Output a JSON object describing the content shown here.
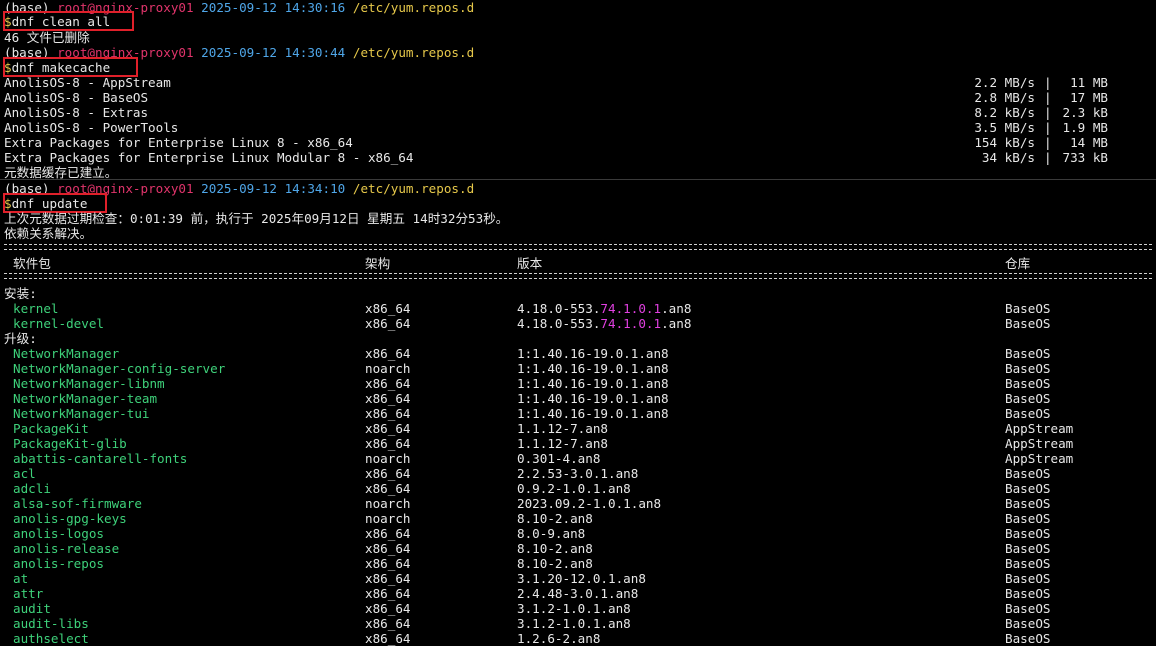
{
  "prompts": [
    {
      "env": "(base)",
      "user": "root@nginx-proxy01",
      "date": "2025-09-12",
      "time": "14:30:16",
      "path": "/etc/yum.repos.d",
      "cmd": "dnf clean all"
    },
    {
      "env": "(base)",
      "user": "root@nginx-proxy01",
      "date": "2025-09-12",
      "time": "14:30:44",
      "path": "/etc/yum.repos.d",
      "cmd": "dnf makecache"
    },
    {
      "env": "(base)",
      "user": "root@nginx-proxy01",
      "date": "2025-09-12",
      "time": "14:34:10",
      "path": "/etc/yum.repos.d",
      "cmd": "dnf update"
    }
  ],
  "dollar": "$",
  "clean_output": "46 文件已删除",
  "repos": [
    {
      "name": "AnolisOS-8 - AppStream",
      "speed": "2.2 MB/s",
      "size": " 11 MB"
    },
    {
      "name": "AnolisOS-8 - BaseOS",
      "speed": "2.8 MB/s",
      "size": " 17 MB"
    },
    {
      "name": "AnolisOS-8 - Extras",
      "speed": "8.2 kB/s",
      "size": "2.3 kB"
    },
    {
      "name": "AnolisOS-8 - PowerTools",
      "speed": "3.5 MB/s",
      "size": "1.9 MB"
    },
    {
      "name": "Extra Packages for Enterprise Linux 8 - x86_64",
      "speed": "154 kB/s",
      "size": " 14 MB"
    },
    {
      "name": "Extra Packages for Enterprise Linux Modular 8 - x86_64",
      "speed": " 34 kB/s",
      "size": "733 kB"
    }
  ],
  "sep_bar": "|",
  "makecache_done": "元数据缓存已建立。",
  "metadata_check": "上次元数据过期检查：0:01:39 前，执行于 2025年09月12日 星期五 14时32分53秒。",
  "deps_resolved": "依赖关系解决。",
  "table_headers": {
    "package": "软件包",
    "arch": "架构",
    "version": "版本",
    "repo": "仓库"
  },
  "section_install": "安装:",
  "section_upgrade": "升级:",
  "install_rows": [
    {
      "name": "kernel",
      "arch": "x86_64",
      "ver_a": "4.18.0-553.",
      "ver_b": "74.1.0.1",
      "ver_c": ".an8",
      "repo": "BaseOS"
    },
    {
      "name": "kernel-devel",
      "arch": "x86_64",
      "ver_a": "4.18.0-553.",
      "ver_b": "74.1.0.1",
      "ver_c": ".an8",
      "repo": "BaseOS"
    }
  ],
  "upgrade_rows": [
    {
      "name": "NetworkManager",
      "arch": "x86_64",
      "ver": "1:1.40.16-19.0.1.an8",
      "repo": "BaseOS"
    },
    {
      "name": "NetworkManager-config-server",
      "arch": "noarch",
      "ver": "1:1.40.16-19.0.1.an8",
      "repo": "BaseOS"
    },
    {
      "name": "NetworkManager-libnm",
      "arch": "x86_64",
      "ver": "1:1.40.16-19.0.1.an8",
      "repo": "BaseOS"
    },
    {
      "name": "NetworkManager-team",
      "arch": "x86_64",
      "ver": "1:1.40.16-19.0.1.an8",
      "repo": "BaseOS"
    },
    {
      "name": "NetworkManager-tui",
      "arch": "x86_64",
      "ver": "1:1.40.16-19.0.1.an8",
      "repo": "BaseOS"
    },
    {
      "name": "PackageKit",
      "arch": "x86_64",
      "ver": "1.1.12-7.an8",
      "repo": "AppStream"
    },
    {
      "name": "PackageKit-glib",
      "arch": "x86_64",
      "ver": "1.1.12-7.an8",
      "repo": "AppStream"
    },
    {
      "name": "abattis-cantarell-fonts",
      "arch": "noarch",
      "ver": "0.301-4.an8",
      "repo": "AppStream"
    },
    {
      "name": "acl",
      "arch": "x86_64",
      "ver": "2.2.53-3.0.1.an8",
      "repo": "BaseOS"
    },
    {
      "name": "adcli",
      "arch": "x86_64",
      "ver": "0.9.2-1.0.1.an8",
      "repo": "BaseOS"
    },
    {
      "name": "alsa-sof-firmware",
      "arch": "noarch",
      "ver": "2023.09.2-1.0.1.an8",
      "repo": "BaseOS"
    },
    {
      "name": "anolis-gpg-keys",
      "arch": "noarch",
      "ver": "8.10-2.an8",
      "repo": "BaseOS"
    },
    {
      "name": "anolis-logos",
      "arch": "x86_64",
      "ver": "8.0-9.an8",
      "repo": "BaseOS"
    },
    {
      "name": "anolis-release",
      "arch": "x86_64",
      "ver": "8.10-2.an8",
      "repo": "BaseOS"
    },
    {
      "name": "anolis-repos",
      "arch": "x86_64",
      "ver": "8.10-2.an8",
      "repo": "BaseOS"
    },
    {
      "name": "at",
      "arch": "x86_64",
      "ver": "3.1.20-12.0.1.an8",
      "repo": "BaseOS"
    },
    {
      "name": "attr",
      "arch": "x86_64",
      "ver": "2.4.48-3.0.1.an8",
      "repo": "BaseOS"
    },
    {
      "name": "audit",
      "arch": "x86_64",
      "ver": "3.1.2-1.0.1.an8",
      "repo": "BaseOS"
    },
    {
      "name": "audit-libs",
      "arch": "x86_64",
      "ver": "3.1.2-1.0.1.an8",
      "repo": "BaseOS"
    },
    {
      "name": "authselect",
      "arch": "x86_64",
      "ver": "1.2.6-2.an8",
      "repo": "BaseOS"
    }
  ]
}
